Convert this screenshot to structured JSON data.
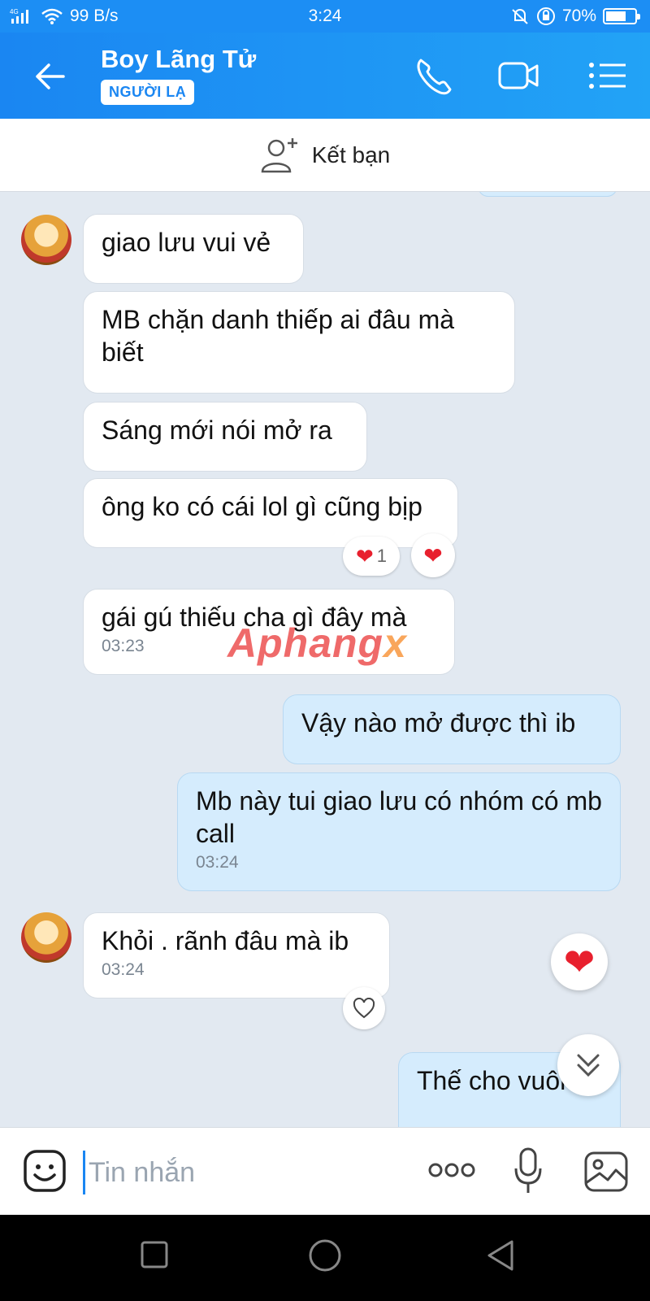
{
  "status_bar": {
    "network": "4G",
    "speed": "99 B/s",
    "time": "3:24",
    "battery": "70%",
    "battery_level": 0.7
  },
  "header": {
    "contact_name": "Boy Lãng Tử",
    "badge": "NGƯỜI LẠ"
  },
  "add_friend": {
    "label": "Kết bạn"
  },
  "messages": {
    "m1": {
      "text": "giao lưu vui vẻ"
    },
    "m2": {
      "text": "MB chặn danh thiếp ai đâu mà biết"
    },
    "m3": {
      "text": "Sáng mới nói mở ra"
    },
    "m4": {
      "text": "ông ko có cái lol gì cũng bịp",
      "reaction_count": "1"
    },
    "m5": {
      "text": "gái gú thiếu cha gì đây mà",
      "time": "03:23"
    },
    "m6": {
      "text": "Vậy nào mở được thì ib"
    },
    "m7": {
      "text": "Mb này tui giao lưu có nhóm có mb call",
      "time": "03:24"
    },
    "m8": {
      "text": "Khỏi . rãnh đâu mà ib",
      "time": "03:24"
    },
    "m9": {
      "text": "Thế cho vuông"
    }
  },
  "watermark": {
    "part1": "Aphang",
    "part2": "x"
  },
  "composer": {
    "placeholder": "Tin nhắn"
  },
  "colors": {
    "primary": "#1a86f2",
    "incoming": "#ffffff",
    "outgoing": "#d5ecfd",
    "heart": "#e8202e"
  }
}
